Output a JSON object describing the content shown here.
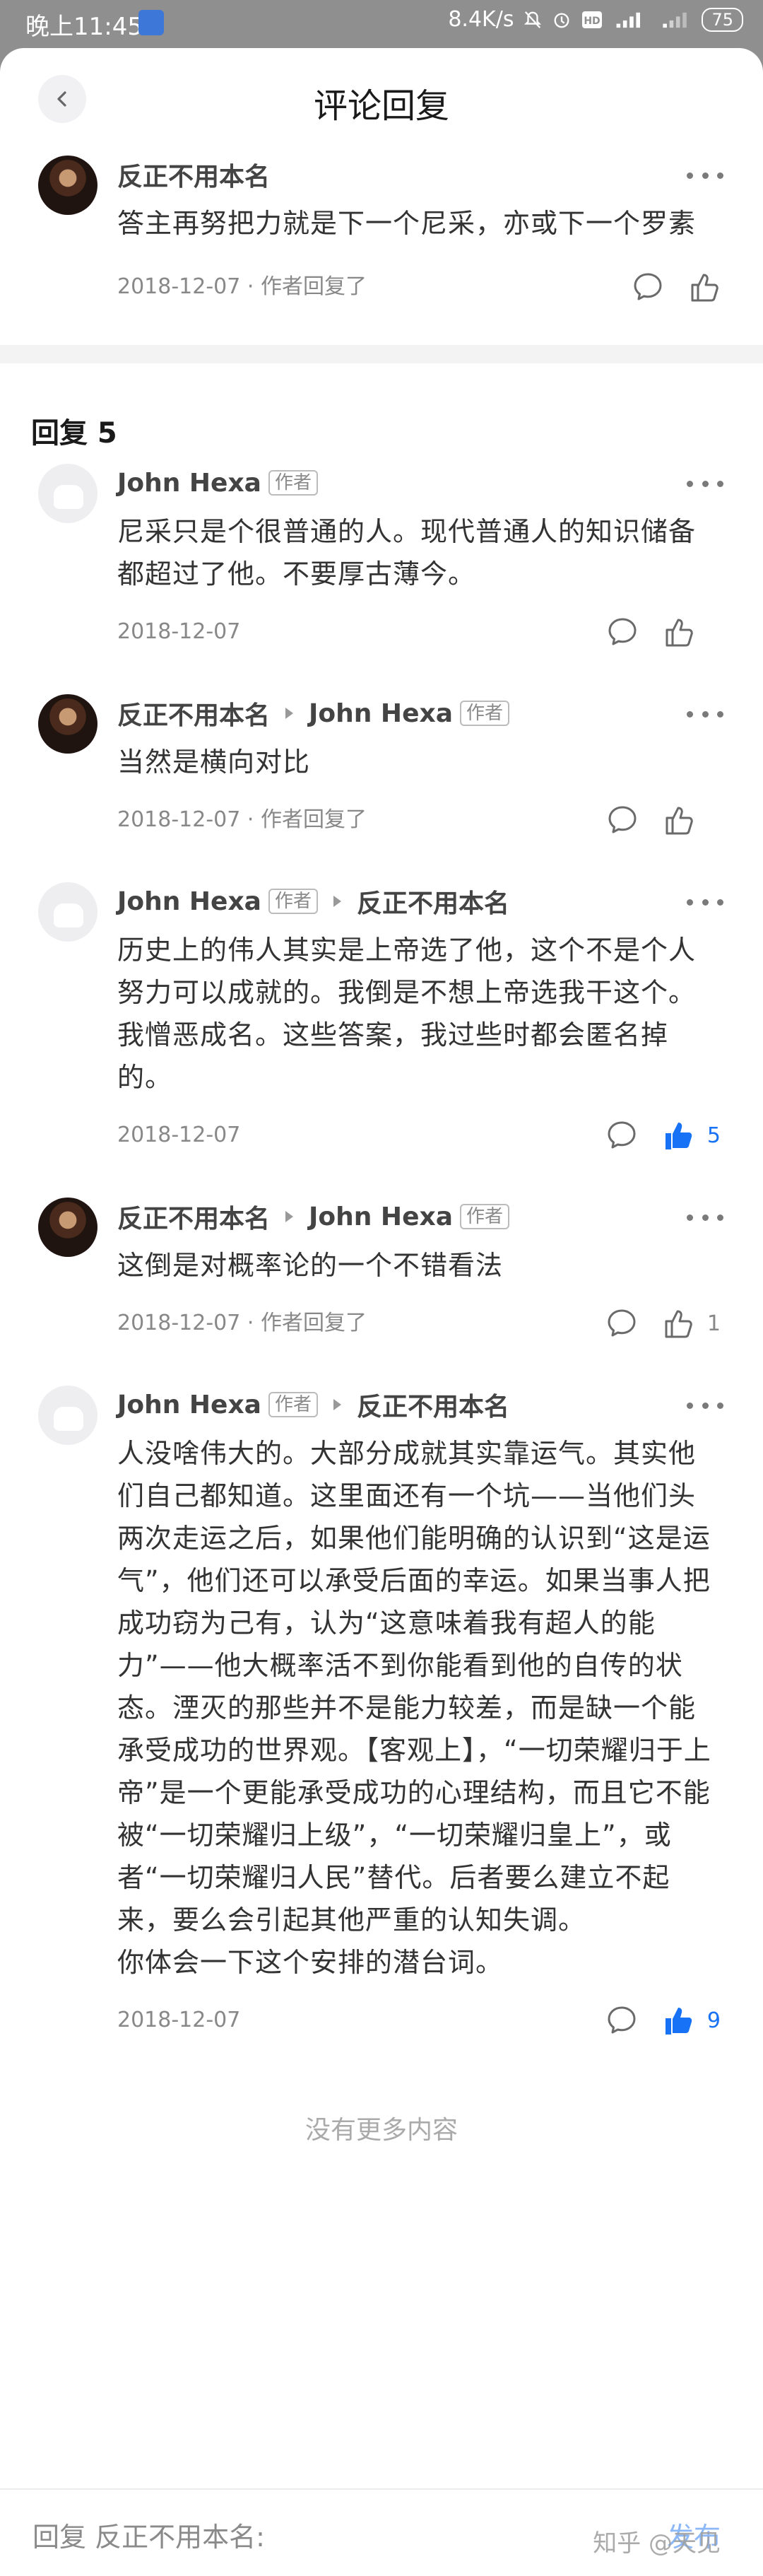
{
  "status": {
    "time": "晚上11:45",
    "speed": "8.4K/s",
    "battery": "75"
  },
  "header": {
    "title": "评论回复"
  },
  "main_comment": {
    "author": "反正不用本名",
    "text": "答主再努把力就是下一个尼采，亦或下一个罗素",
    "meta": "2018-12-07 · 作者回复了"
  },
  "replies_header": "回复 5",
  "author_tag": "作者",
  "replies": [
    {
      "author": "John Hexa",
      "text": "尼采只是个很普通的人。现代普通人的知识储备都超过了他。不要厚古薄今。",
      "meta": "2018-12-07",
      "likes": ""
    },
    {
      "author": "反正不用本名",
      "reply_to": "John Hexa",
      "text": "当然是横向对比",
      "meta": "2018-12-07 · 作者回复了",
      "likes": ""
    },
    {
      "author": "John Hexa",
      "reply_to": "反正不用本名",
      "text": "历史上的伟人其实是上帝选了他，这个不是个人努力可以成就的。我倒是不想上帝选我干这个。我憎恶成名。这些答案，我过些时都会匿名掉的。",
      "meta": "2018-12-07",
      "likes": "5"
    },
    {
      "author": "反正不用本名",
      "reply_to": "John Hexa",
      "text": "这倒是对概率论的一个不错看法",
      "meta": "2018-12-07 · 作者回复了",
      "likes": "1"
    },
    {
      "author": "John Hexa",
      "reply_to": "反正不用本名",
      "text": "人没啥伟大的。大部分成就其实靠运气。其实他们自己都知道。这里面还有一个坑——当他们头两次走运之后，如果他们能明确的认识到“这是运气”，他们还可以承受后面的幸运。如果当事人把成功窃为己有，认为“这意味着我有超人的能力”——他大概率活不到你能看到他的自传的状态。湮灭的那些并不是能力较差，而是缺一个能承受成功的世界观。【客观上】，“一切荣耀归于上帝”是一个更能承受成功的心理结构，而且它不能被“一切荣耀归上级”，“一切荣耀归皇上”，或者“一切荣耀归人民”替代。后者要么建立不起来，要么会引起其他严重的认知失调。",
      "text2": "你体会一下这个安排的潜台词。",
      "meta": "2018-12-07",
      "likes": "9"
    }
  ],
  "no_more": "没有更多内容",
  "bottom": {
    "placeholder": "回复 反正不用本名:",
    "send": "发布",
    "watermark": "知乎 @天见"
  },
  "colors": {
    "accent": "#1772f6",
    "muted": "#888888"
  }
}
